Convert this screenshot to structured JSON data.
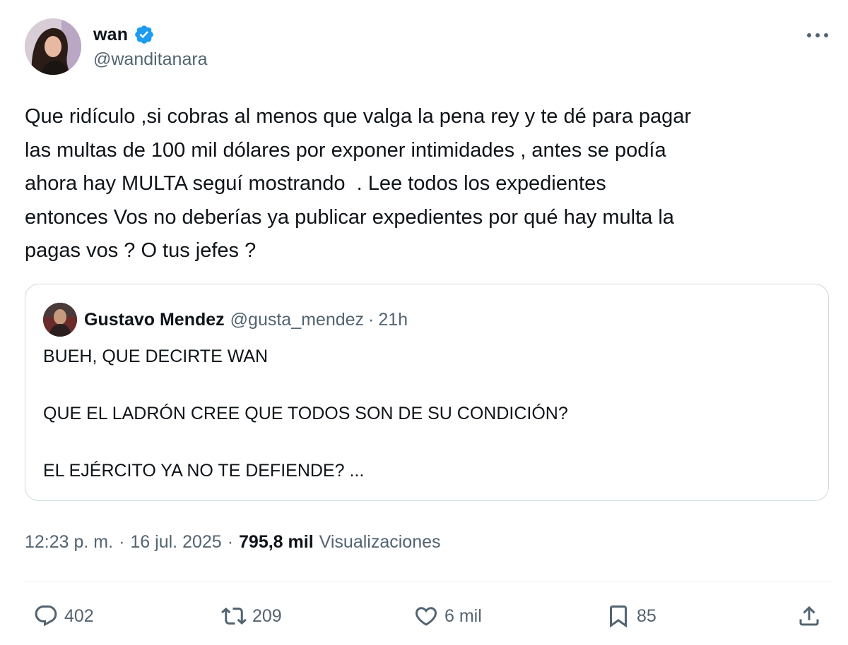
{
  "author": {
    "display_name": "wan",
    "handle": "@wanditanara"
  },
  "tweet": {
    "text": "Que ridículo ,si cobras al menos que valga la pena rey y te dé para pagar\nlas multas de 100 mil dólares por exponer intimidades , antes se podía\nahora hay MULTA seguí mostrando  . Lee todos los expedientes\nentonces Vos no deberías ya publicar expedientes por qué hay multa la\npagas vos ? O tus jefes ?"
  },
  "quote": {
    "display_name": "Gustavo Mendez",
    "handle": "@gusta_mendez",
    "separator": "·",
    "time": "21h",
    "text": "BUEH, QUE DECIRTE WAN\n\nQUE EL LADRÓN CREE QUE TODOS SON DE SU CONDICIÓN?\n\nEL EJÉRCITO YA NO TE DEFIENDE? ..."
  },
  "meta": {
    "time": "12:23 p. m.",
    "date": "16 jul. 2025",
    "separator": "·",
    "views_count": "795,8 mil",
    "views_label": "Visualizaciones"
  },
  "actions": {
    "replies": "402",
    "reposts": "209",
    "likes": "6 mil",
    "bookmarks": "85"
  },
  "icons": {
    "verified": "verified-badge-icon",
    "more": "more-options-icon",
    "reply": "reply-icon",
    "repost": "repost-icon",
    "like": "heart-icon",
    "bookmark": "bookmark-icon",
    "share": "share-icon"
  },
  "colors": {
    "verified_blue": "#1d9bf0",
    "secondary_text": "#536471",
    "primary_text": "#0f1419",
    "border": "#cfd9de"
  }
}
